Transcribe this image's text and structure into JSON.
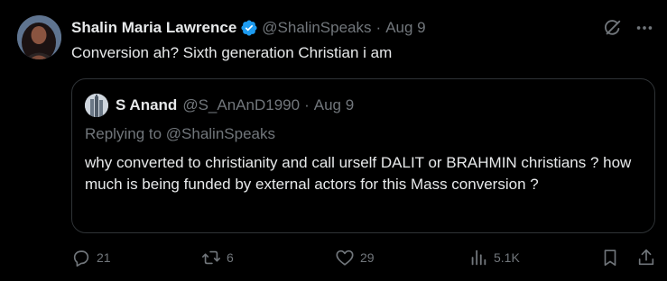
{
  "tweet": {
    "author": {
      "display_name": "Shalin Maria Lawrence",
      "handle": "@ShalinSpeaks",
      "verified": true
    },
    "separator": "·",
    "date": "Aug 9",
    "text": "Conversion ah? Sixth generation Christian i am",
    "top_icons": [
      "grok-icon",
      "more-icon"
    ]
  },
  "quote": {
    "author": {
      "display_name": "S Anand",
      "handle": "@S_AnAnD1990"
    },
    "separator": "·",
    "date": "Aug 9",
    "replying_to": "Replying to @ShalinSpeaks",
    "text": "why converted to christianity and call urself DALIT or BRAHMIN christians ? how much is being funded by external actors  for this Mass conversion ?"
  },
  "actions": {
    "reply": "21",
    "repost": "6",
    "like": "29",
    "views": "5.1K"
  },
  "colors": {
    "background": "#000000",
    "text": "#e7e9ea",
    "secondary": "#71767b",
    "border": "#2f3336",
    "verified": "#1d9bf0"
  }
}
